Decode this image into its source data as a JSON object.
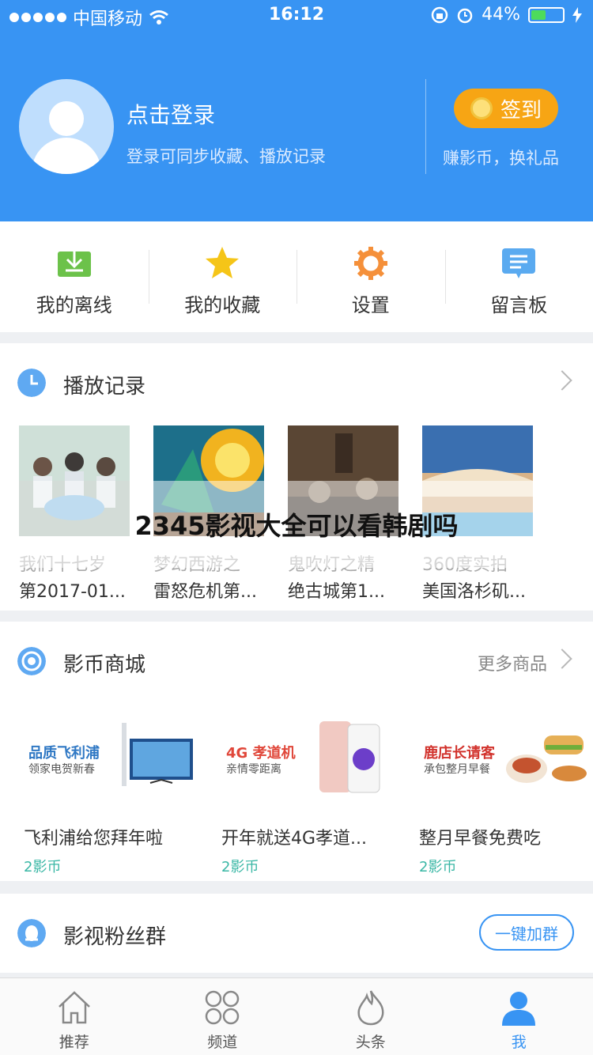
{
  "status": {
    "carrier": "中国移动",
    "time": "16:12",
    "battery": "44%",
    "battery_level": 0.44
  },
  "profile": {
    "title": "点击登录",
    "subtitle": "登录可同步收藏、播放记录",
    "signin_label": "签到",
    "earn_label": "赚影币，换礼品"
  },
  "quick": [
    {
      "label": "我的离线",
      "icon": "download-icon"
    },
    {
      "label": "我的收藏",
      "icon": "star-icon"
    },
    {
      "label": "设置",
      "icon": "gear-icon"
    },
    {
      "label": "留言板",
      "icon": "message-icon"
    }
  ],
  "history": {
    "title": "播放记录",
    "items": [
      {
        "line1": "我们十七岁",
        "line2": "第2017-01..."
      },
      {
        "line1": "梦幻西游之",
        "line2": "雷怒危机第..."
      },
      {
        "line1": "鬼吹灯之精",
        "line2": "绝古城第1..."
      },
      {
        "line1": "360度实拍",
        "line2": "美国洛杉矶..."
      }
    ]
  },
  "overlay": {
    "text": "2345影视大全可以看韩剧吗"
  },
  "shop": {
    "title": "影币商城",
    "more": "更多商品",
    "items": [
      {
        "title": "飞利浦给您拜年啦",
        "price": "2影币",
        "banner_main": "品质飞利浦",
        "banner_sub": "领家电贺新春"
      },
      {
        "title": "开年就送4G孝道...",
        "price": "2影币",
        "banner_main": "4G 孝道机",
        "banner_sub": "亲情零距离"
      },
      {
        "title": "整月早餐免费吃",
        "price": "2影币",
        "banner_main": "鹿店长请客",
        "banner_sub": "承包整月早餐"
      }
    ]
  },
  "fans": {
    "title": "影视粉丝群",
    "join": "一键加群"
  },
  "tabs": [
    {
      "label": "推荐",
      "icon": "home-icon"
    },
    {
      "label": "频道",
      "icon": "grid-icon"
    },
    {
      "label": "头条",
      "icon": "flame-icon"
    },
    {
      "label": "我",
      "icon": "person-icon"
    }
  ],
  "colors": {
    "brand": "#3894f3",
    "signin": "#f7a514",
    "price": "#3ab7a5"
  }
}
